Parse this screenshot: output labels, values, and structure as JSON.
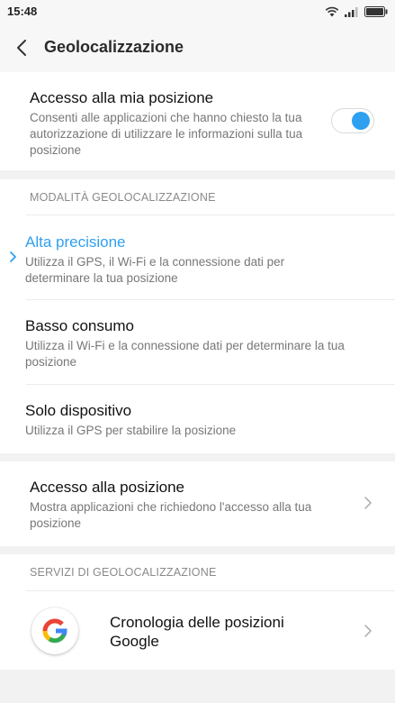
{
  "status_bar": {
    "time": "15:48",
    "icons": [
      "wifi-icon",
      "signal-icon",
      "battery-icon"
    ]
  },
  "app_bar": {
    "title": "Geolocalizzazione",
    "back_icon": "back-arrow-icon"
  },
  "location_access": {
    "title": "Accesso alla mia posizione",
    "description": "Consenti alle applicazioni che hanno chiesto la tua autorizzazione di utilizzare le informazioni sulla tua posizione",
    "toggle_on": true
  },
  "mode_section": {
    "header": "MODALITÀ GEOLOCALIZZAZIONE",
    "options": [
      {
        "title": "Alta precisione",
        "description": "Utilizza il GPS, il Wi-Fi e la connessione dati per determinare la tua posizione",
        "selected": true
      },
      {
        "title": "Basso consumo",
        "description": "Utilizza il Wi-Fi e la connessione dati per determinare la tua posizione",
        "selected": false
      },
      {
        "title": "Solo dispositivo",
        "description": "Utilizza il GPS per stabilire la posizione",
        "selected": false
      }
    ]
  },
  "position_access": {
    "title": "Accesso alla posizione",
    "description": "Mostra applicazioni che richiedono l'accesso alla tua posizione"
  },
  "services_section": {
    "header": "SERVIZI DI GEOLOCALIZZAZIONE",
    "google_history": {
      "title": "Cronologia delle posizioni Google",
      "icon": "google-logo-icon"
    }
  },
  "colors": {
    "accent": "#2f9ff0",
    "background": "#f2f2f2",
    "card": "#ffffff",
    "secondary_text": "#777777"
  }
}
